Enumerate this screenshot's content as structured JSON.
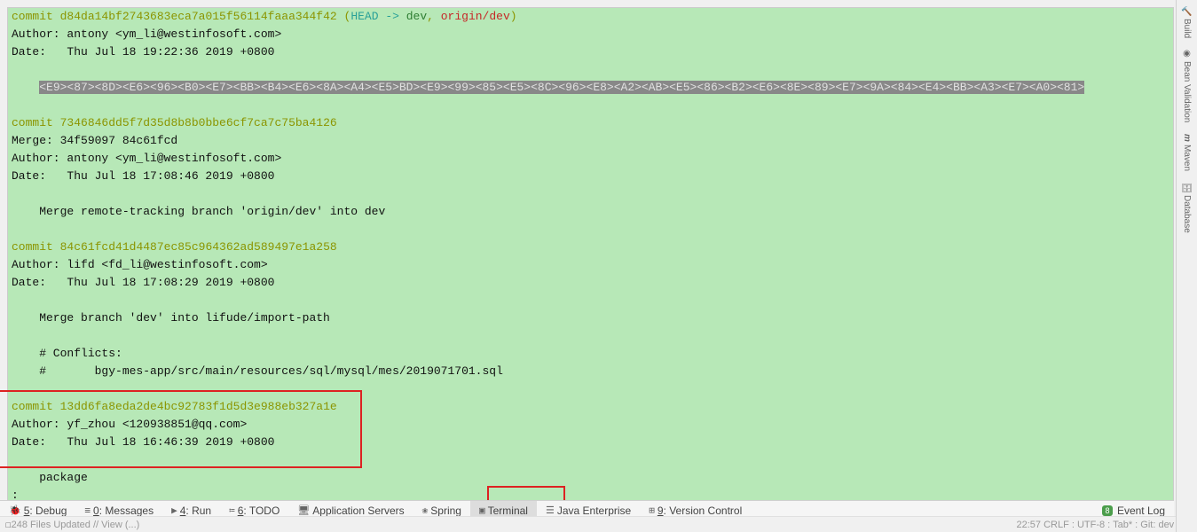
{
  "commits": {
    "c1": {
      "label": "commit",
      "hash": "d84da14bf2743683eca7a015f56114faaa344f42",
      "head": "HEAD -> ",
      "dev": "dev",
      "sep": ", ",
      "origin": "origin/dev",
      "author": "Author: antony <ym_li@westinfosoft.com>",
      "date": "Date:   Thu Jul 18 19:22:36 2019 +0800",
      "msg": "    <E9><87><8D><E6><96><B0><E7><BB><B4><E6><8A><A4><E5>BD><E9><99><85><E5><8C><96><E8><A2><AB><E5><86><B2><E6><8E><89><E7><9A><84><E4><BB><A3><E7><A0><81>"
    },
    "c2": {
      "label": "commit",
      "hash": "7346846dd5f7d35d8b8b0bbe6cf7ca7c75ba4126",
      "merge": "Merge: 34f59097 84c61fcd",
      "author": "Author: antony <ym_li@westinfosoft.com>",
      "date": "Date:   Thu Jul 18 17:08:46 2019 +0800",
      "msg": "    Merge remote-tracking branch 'origin/dev' into dev"
    },
    "c3": {
      "label": "commit",
      "hash": "84c61fcd41d4487ec85c964362ad589497e1a258",
      "author": "Author: lifd <fd_li@westinfosoft.com>",
      "date": "Date:   Thu Jul 18 17:08:29 2019 +0800",
      "msg1": "    Merge branch 'dev' into lifude/import-path",
      "msg2": "    # Conflicts:",
      "msg3": "    #       bgy-mes-app/src/main/resources/sql/mysql/mes/2019071701.sql"
    },
    "c4": {
      "label": "commit",
      "hash": "13dd6fa8eda2de4bc92783f1d5d3e988eb327a1e",
      "author": "Author: yf_zhou <120938851@qq.com>",
      "date": "Date:   Thu Jul 18 16:46:39 2019 +0800",
      "msg": "    package"
    },
    "prompt": ":"
  },
  "tabs": {
    "debug": "5: Debug",
    "messages": "0: Messages",
    "run": "4: Run",
    "todo": "6: TODO",
    "appservers": "Application Servers",
    "spring": "Spring",
    "terminal": "Terminal",
    "javaee": "Java Enterprise",
    "vc": "9: Version Control",
    "eventlog": "Event Log"
  },
  "right": {
    "build": "Build",
    "bean": "Bean Validation",
    "maven": "Maven",
    "db": "Database"
  },
  "status": {
    "left": "   248 Files Updated // View (...)",
    "right": "22:57  CRLF :  UTF-8 :  Tab* :    Git: dev :  "
  }
}
